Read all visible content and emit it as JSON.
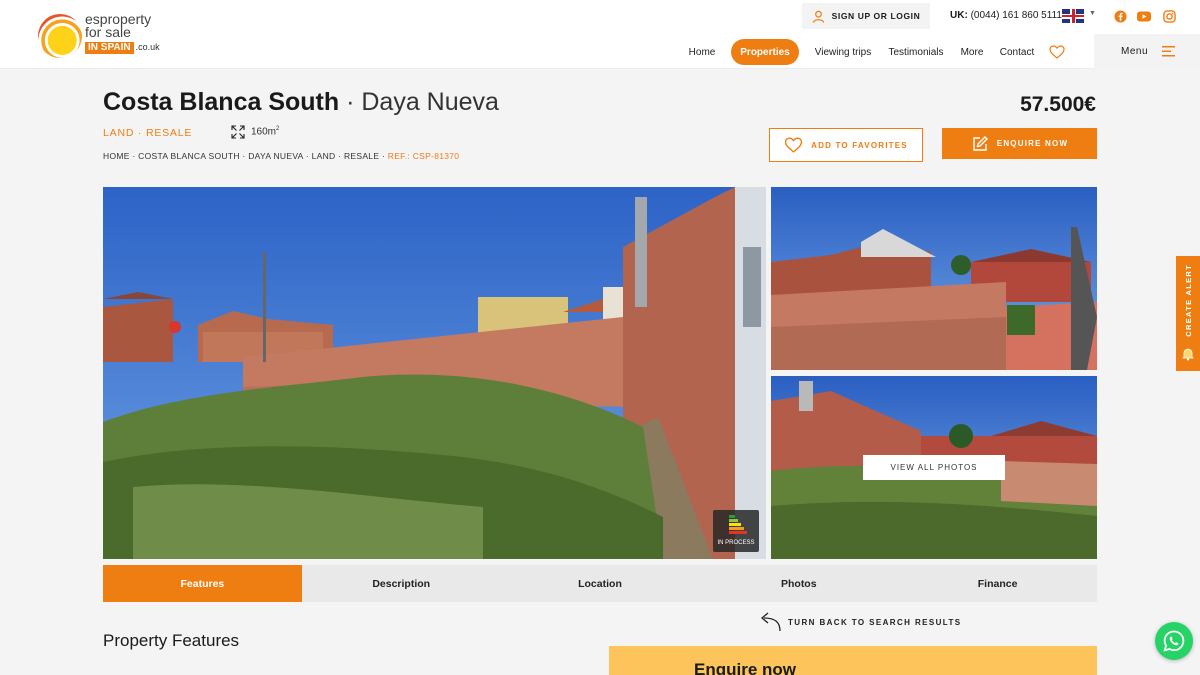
{
  "brand": {
    "line1": "esproperty",
    "line2": "for sale",
    "badge": "IN SPAIN",
    "tld": ".co.uk"
  },
  "topbar": {
    "signup_label": "SIGN UP OR LOGIN",
    "phone_prefix": "UK:",
    "phone_number": "(0044) 161 860 5111"
  },
  "nav": {
    "home": "Home",
    "properties": "Properties",
    "viewing_trips": "Viewing trips",
    "testimonials": "Testimonials",
    "more": "More",
    "contact": "Contact",
    "menu": "Menu"
  },
  "listing": {
    "region": "Costa Blanca South",
    "separator": " · ",
    "town": "Daya Nueva",
    "price": "57.500€",
    "type": "LAND · RESALE",
    "area": "160m",
    "area_unit_sup": "2",
    "breadcrumb": "HOME · COSTA BLANCA SOUTH · DAYA NUEVA · LAND · RESALE · ",
    "ref": "REF.: CSP-81370"
  },
  "actions": {
    "favorites": "ADD TO FAVORITES",
    "enquire": "ENQUIRE NOW",
    "view_all_photos": "VIEW ALL PHOTOS",
    "back_to_results": "TURN BACK TO SEARCH RESULTS"
  },
  "energy_label": "IN PROCESS",
  "tabs": [
    "Features",
    "Description",
    "Location",
    "Photos",
    "Finance"
  ],
  "active_tab": "Features",
  "sections": {
    "features_title": "Property Features",
    "enquire_title": "Enquire now"
  },
  "side": {
    "create_alert": "CREATE ALERT"
  },
  "colors": {
    "accent": "#ee7d12",
    "enquire_box": "#fcc45b"
  }
}
